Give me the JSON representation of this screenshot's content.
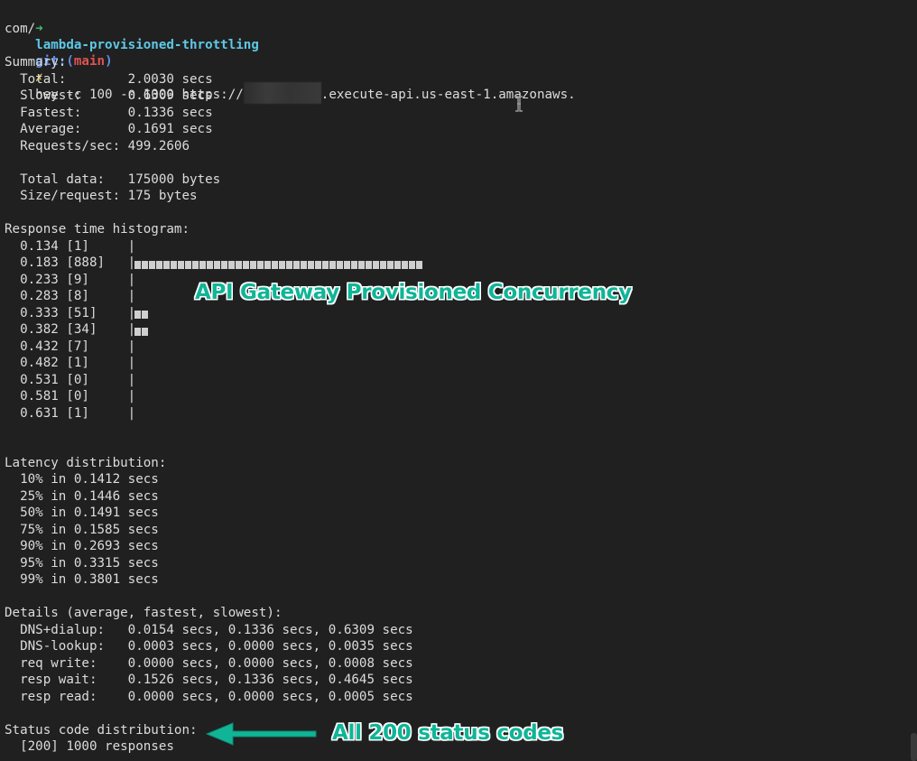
{
  "command": {
    "prompt_arrow": "➜",
    "directory": "lambda-provisioned-throttling",
    "git_prefix": "git:(",
    "branch": "main",
    "git_suffix": ")",
    "dirty_mark": "✗",
    "text_before_redaction": "hey -c 100 -n 1000 https://",
    "text_after_redaction": ".execute-api.us-east-1.amazonaws.",
    "text_wrapped": "com/"
  },
  "summary": {
    "heading": "Summary:",
    "lines": [
      "  Total:        2.0030 secs",
      "  Slowest:      0.6309 secs",
      "  Fastest:      0.1336 secs",
      "  Average:      0.1691 secs",
      "  Requests/sec: 499.2606",
      "  Total data:   175000 bytes",
      "  Size/request: 175 bytes"
    ]
  },
  "histogram": {
    "heading": "Response time histogram:",
    "rows": [
      {
        "label": "  0.134 [1]     |",
        "count": 1
      },
      {
        "label": "  0.183 [888]   |",
        "count": 888
      },
      {
        "label": "  0.233 [9]     |",
        "count": 9
      },
      {
        "label": "  0.283 [8]     |",
        "count": 8
      },
      {
        "label": "  0.333 [51]    |",
        "count": 51
      },
      {
        "label": "  0.382 [34]    |",
        "count": 34
      },
      {
        "label": "  0.432 [7]     |",
        "count": 7
      },
      {
        "label": "  0.482 [1]     |",
        "count": 1
      },
      {
        "label": "  0.531 [0]     |",
        "count": 0
      },
      {
        "label": "  0.581 [0]     |",
        "count": 0
      },
      {
        "label": "  0.631 [1]     |",
        "count": 1
      }
    ]
  },
  "latency": {
    "heading": "Latency distribution:",
    "lines": [
      "  10% in 0.1412 secs",
      "  25% in 0.1446 secs",
      "  50% in 0.1491 secs",
      "  75% in 0.1585 secs",
      "  90% in 0.2693 secs",
      "  95% in 0.3315 secs",
      "  99% in 0.3801 secs"
    ]
  },
  "details": {
    "heading": "Details (average, fastest, slowest):",
    "lines": [
      "  DNS+dialup:   0.0154 secs, 0.1336 secs, 0.6309 secs",
      "  DNS-lookup:   0.0003 secs, 0.0000 secs, 0.0035 secs",
      "  req write:    0.0000 secs, 0.0000 secs, 0.0008 secs",
      "  resp wait:    0.1526 secs, 0.1336 secs, 0.4645 secs",
      "  resp read:    0.0000 secs, 0.0000 secs, 0.0005 secs"
    ]
  },
  "status": {
    "heading": "Status code distribution:",
    "line": "  [200] 1000 responses"
  },
  "annotations": {
    "histogram_note": "API Gateway Provisioned Concurrency",
    "status_note": "All 200 status codes"
  },
  "colors": {
    "background": "#202020",
    "text": "#dcdcdc",
    "annotation": "#0fb596",
    "prompt_arrow": "#3fbf6f",
    "directory": "#5ec8e6",
    "git": "#5c8fe6",
    "branch": "#e05252"
  }
}
